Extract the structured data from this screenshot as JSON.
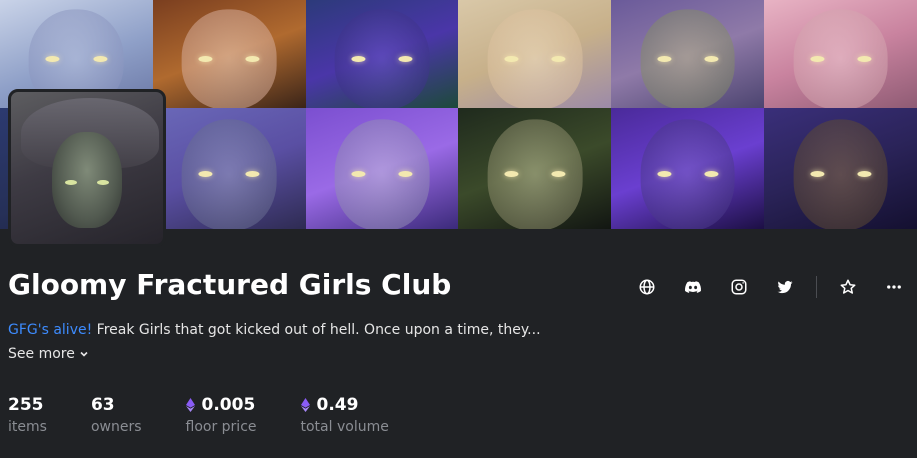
{
  "collection": {
    "title": "Gloomy Fractured Girls Club",
    "description": {
      "link_text": "GFG's alive!",
      "text": " Freak Girls that got kicked out of hell. Once upon a time, they..."
    },
    "see_more_label": "See more"
  },
  "social": {
    "icons": [
      "globe-icon",
      "discord-icon",
      "instagram-icon",
      "twitter-icon",
      "star-icon",
      "more-icon"
    ]
  },
  "stats": [
    {
      "value": "255",
      "label": "items",
      "currency_icon": false
    },
    {
      "value": "63",
      "label": "owners",
      "currency_icon": false
    },
    {
      "value": "0.005",
      "label": "floor price",
      "currency_icon": true
    },
    {
      "value": "0.49",
      "label": "total volume",
      "currency_icon": true
    }
  ],
  "colors": {
    "background": "#202225",
    "link": "#3d8bfd",
    "muted_text": "#8a8d93",
    "eth_icon": "#8a5cf6"
  }
}
